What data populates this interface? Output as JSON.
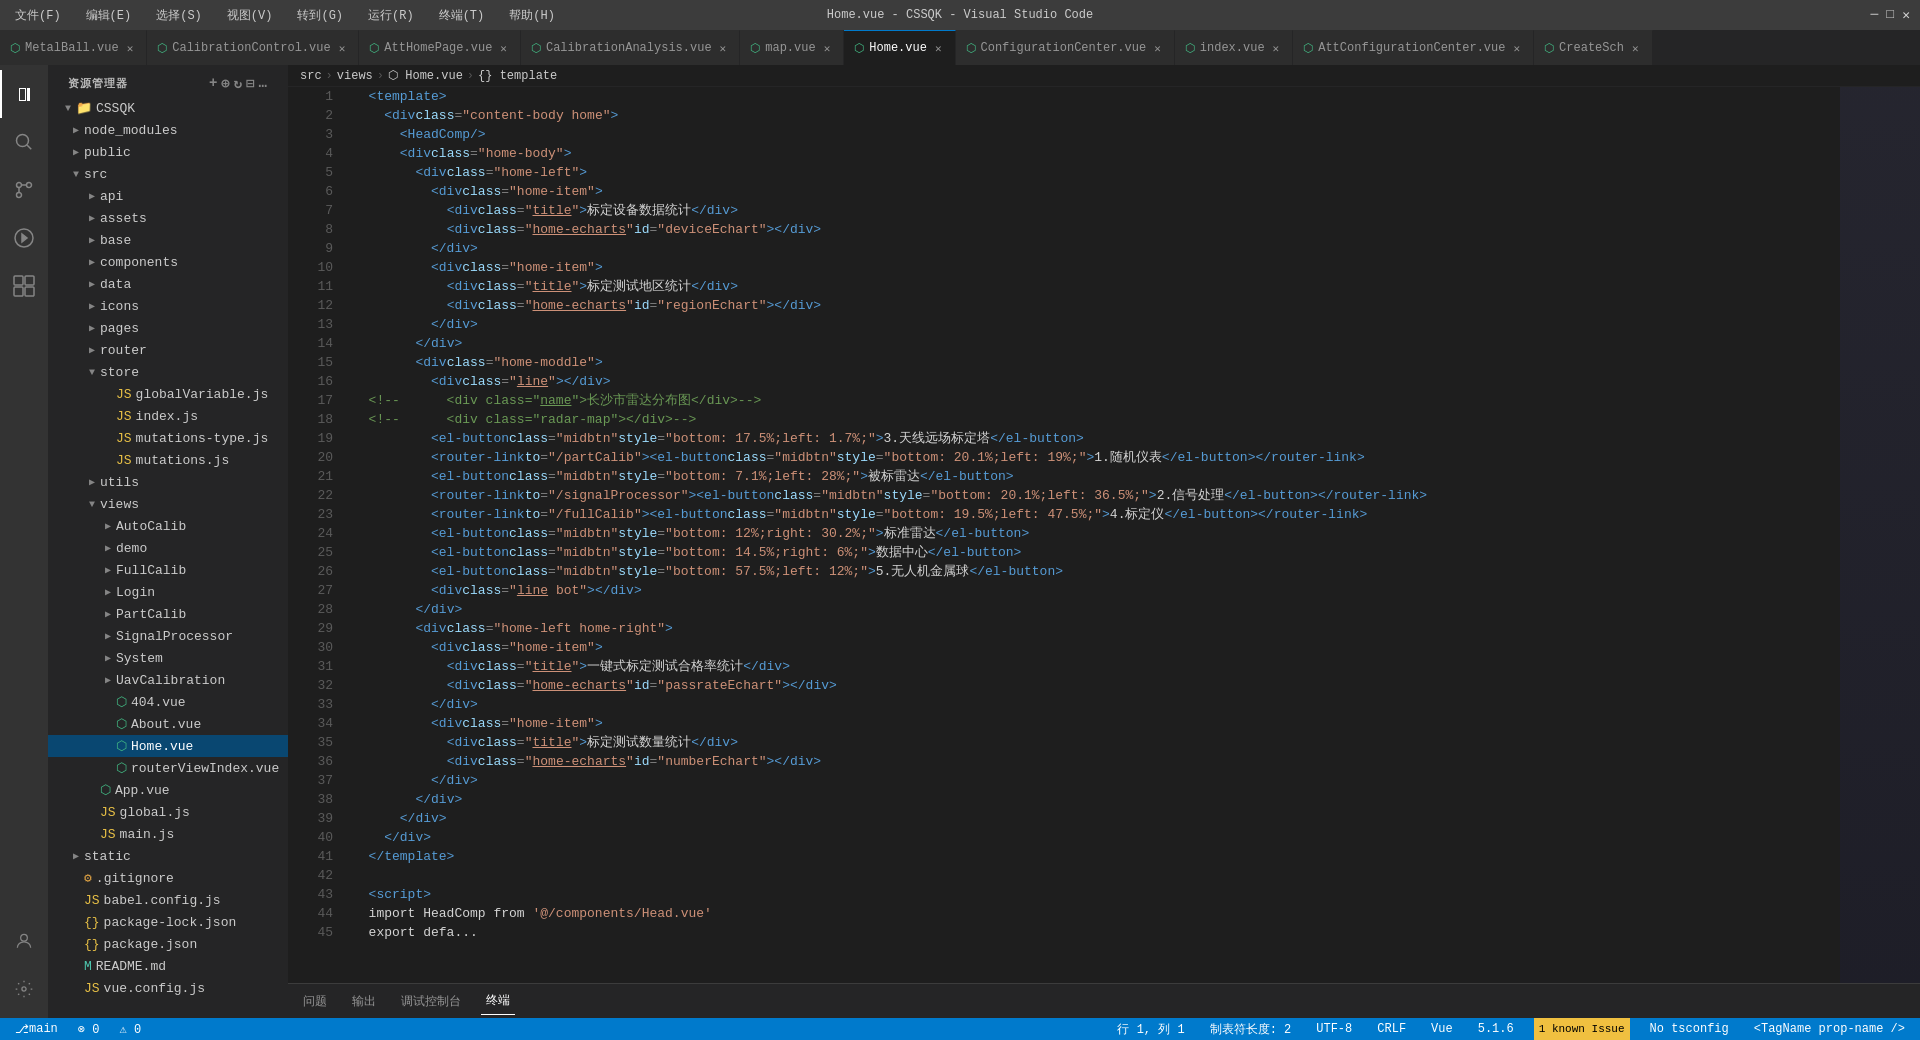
{
  "titleBar": {
    "title": "Home.vue - CSSQK - Visual Studio Code",
    "menu": [
      "文件(F)",
      "编辑(E)",
      "选择(S)",
      "视图(V)",
      "转到(G)",
      "运行(R)",
      "终端(T)",
      "帮助(H)"
    ]
  },
  "tabs": [
    {
      "id": "tab-metalball",
      "label": "MetalBall.vue",
      "active": false,
      "modified": false,
      "icon": "vue"
    },
    {
      "id": "tab-calibration",
      "label": "CalibrationControl.vue",
      "active": false,
      "modified": false,
      "icon": "vue"
    },
    {
      "id": "tab-atthome",
      "label": "AttHomePage.vue",
      "active": false,
      "modified": false,
      "icon": "vue"
    },
    {
      "id": "tab-calibanalysis",
      "label": "CalibrationAnalysis.vue",
      "active": false,
      "modified": false,
      "icon": "vue"
    },
    {
      "id": "tab-map",
      "label": "map.vue",
      "active": false,
      "modified": false,
      "icon": "vue"
    },
    {
      "id": "tab-homevue",
      "label": "Home.vue",
      "active": true,
      "modified": false,
      "icon": "vue"
    },
    {
      "id": "tab-configcenter",
      "label": "ConfigurationCenter.vue",
      "active": false,
      "modified": false,
      "icon": "vue"
    },
    {
      "id": "tab-index",
      "label": "index.vue",
      "active": false,
      "modified": false,
      "icon": "vue"
    },
    {
      "id": "tab-attconfig",
      "label": "AttConfigurationCenter.vue",
      "active": false,
      "modified": false,
      "icon": "vue"
    },
    {
      "id": "tab-createsch",
      "label": "CreateSch",
      "active": false,
      "modified": false,
      "icon": "vue"
    }
  ],
  "breadcrumb": {
    "items": [
      "src",
      "views",
      "Home.vue",
      "{} template"
    ]
  },
  "sidebar": {
    "title": "资源管理器",
    "root": "CSSQK",
    "tree": [
      {
        "label": "node_modules",
        "level": 1,
        "type": "folder",
        "open": false,
        "icon": "folder"
      },
      {
        "label": "public",
        "level": 1,
        "type": "folder",
        "open": false,
        "icon": "folder"
      },
      {
        "label": "src",
        "level": 1,
        "type": "folder",
        "open": true,
        "icon": "folder"
      },
      {
        "label": "api",
        "level": 2,
        "type": "folder",
        "open": false,
        "icon": "folder"
      },
      {
        "label": "assets",
        "level": 2,
        "type": "folder",
        "open": false,
        "icon": "folder"
      },
      {
        "label": "base",
        "level": 2,
        "type": "folder",
        "open": false,
        "icon": "folder"
      },
      {
        "label": "components",
        "level": 2,
        "type": "folder",
        "open": false,
        "icon": "folder"
      },
      {
        "label": "data",
        "level": 2,
        "type": "folder",
        "open": false,
        "icon": "folder"
      },
      {
        "label": "icons",
        "level": 2,
        "type": "folder",
        "open": false,
        "icon": "folder"
      },
      {
        "label": "pages",
        "level": 2,
        "type": "folder",
        "open": false,
        "icon": "folder"
      },
      {
        "label": "router",
        "level": 2,
        "type": "folder",
        "open": false,
        "icon": "folder"
      },
      {
        "label": "store",
        "level": 2,
        "type": "folder",
        "open": true,
        "icon": "folder"
      },
      {
        "label": "globalVariable.js",
        "level": 3,
        "type": "js",
        "icon": "js"
      },
      {
        "label": "index.js",
        "level": 3,
        "type": "js",
        "icon": "js"
      },
      {
        "label": "mutations-type.js",
        "level": 3,
        "type": "js",
        "icon": "js"
      },
      {
        "label": "mutations.js",
        "level": 3,
        "type": "js",
        "icon": "js"
      },
      {
        "label": "utils",
        "level": 2,
        "type": "folder",
        "open": false,
        "icon": "folder"
      },
      {
        "label": "views",
        "level": 2,
        "type": "folder",
        "open": true,
        "icon": "folder"
      },
      {
        "label": "AutoCalib",
        "level": 3,
        "type": "folder",
        "open": false,
        "icon": "folder"
      },
      {
        "label": "demo",
        "level": 3,
        "type": "folder",
        "open": false,
        "icon": "folder"
      },
      {
        "label": "FullCalib",
        "level": 3,
        "type": "folder",
        "open": false,
        "icon": "folder"
      },
      {
        "label": "Login",
        "level": 3,
        "type": "folder",
        "open": false,
        "icon": "folder"
      },
      {
        "label": "PartCalib",
        "level": 3,
        "type": "folder",
        "open": false,
        "icon": "folder"
      },
      {
        "label": "SignalProcessor",
        "level": 3,
        "type": "folder",
        "open": false,
        "icon": "folder"
      },
      {
        "label": "System",
        "level": 3,
        "type": "folder",
        "open": false,
        "icon": "folder"
      },
      {
        "label": "UavCalibration",
        "level": 3,
        "type": "folder",
        "open": false,
        "icon": "folder"
      },
      {
        "label": "404.vue",
        "level": 3,
        "type": "vue",
        "icon": "vue"
      },
      {
        "label": "About.vue",
        "level": 3,
        "type": "vue",
        "icon": "vue"
      },
      {
        "label": "Home.vue",
        "level": 3,
        "type": "vue",
        "active": true,
        "icon": "vue"
      },
      {
        "label": "routerViewIndex.vue",
        "level": 3,
        "type": "vue",
        "icon": "vue"
      },
      {
        "label": "App.vue",
        "level": 2,
        "type": "vue",
        "icon": "vue"
      },
      {
        "label": "global.js",
        "level": 2,
        "type": "js",
        "icon": "js"
      },
      {
        "label": "main.js",
        "level": 2,
        "type": "js",
        "icon": "js"
      },
      {
        "label": "static",
        "level": 1,
        "type": "folder",
        "open": false,
        "icon": "folder"
      },
      {
        "label": ".gitignore",
        "level": 1,
        "type": "git",
        "icon": "git"
      },
      {
        "label": "babel.config.js",
        "level": 1,
        "type": "js",
        "icon": "js"
      },
      {
        "label": "package-lock.json",
        "level": 1,
        "type": "json",
        "icon": "json"
      },
      {
        "label": "package.json",
        "level": 1,
        "type": "json",
        "icon": "json"
      },
      {
        "label": "README.md",
        "level": 1,
        "type": "md",
        "icon": "md"
      },
      {
        "label": "vue.config.js",
        "level": 1,
        "type": "js",
        "icon": "js"
      }
    ]
  },
  "code": [
    {
      "num": 1,
      "text": "  <template>"
    },
    {
      "num": 2,
      "text": "    <div class=\"content-body home\">"
    },
    {
      "num": 3,
      "text": "      <HeadComp/>"
    },
    {
      "num": 4,
      "text": "      <div class=\"home-body\">"
    },
    {
      "num": 5,
      "text": "        <div class=\"home-left\">"
    },
    {
      "num": 6,
      "text": "          <div class=\"home-item\">"
    },
    {
      "num": 7,
      "text": "            <div class=\"title\">标定设备数据统计</div>"
    },
    {
      "num": 8,
      "text": "            <div class=\"home-echarts\" id=\"deviceEchart\"></div>"
    },
    {
      "num": 9,
      "text": "          </div>"
    },
    {
      "num": 10,
      "text": "          <div class=\"home-item\">"
    },
    {
      "num": 11,
      "text": "            <div class=\"title\">标定测试地区统计</div>"
    },
    {
      "num": 12,
      "text": "            <div class=\"home-echarts\" id=\"regionEchart\"></div>"
    },
    {
      "num": 13,
      "text": "          </div>"
    },
    {
      "num": 14,
      "text": "        </div>"
    },
    {
      "num": 15,
      "text": "        <div class=\"home-moddle\">"
    },
    {
      "num": 16,
      "text": "          <div class=\"line\"></div>"
    },
    {
      "num": 17,
      "text": "  <!--      <div class=\"name\">长沙市雷达分布图</div>-->"
    },
    {
      "num": 18,
      "text": "  <!--      <div class=\"radar-map\"></div>-->"
    },
    {
      "num": 19,
      "text": "          <el-button class=\"midbtn\" style=\"bottom: 17.5%;left: 1.7%;\">3.天线远场标定塔</el-button>"
    },
    {
      "num": 20,
      "text": "          <router-link to=\"/partCalib\"><el-button class=\"midbtn\" style=\"bottom: 20.1%;left: 19%;\">1.随机仪表</el-button></router-link>"
    },
    {
      "num": 21,
      "text": "          <el-button class=\"midbtn\" style=\"bottom: 7.1%;left: 28%;\">被标雷达</el-button>"
    },
    {
      "num": 22,
      "text": "          <router-link to=\"/signalProcessor\"><el-button class=\"midbtn\" style=\"bottom: 20.1%;left: 36.5%;\">2.信号处理</el-button></router-link>"
    },
    {
      "num": 23,
      "text": "          <router-link to=\"/fullCalib\"><el-button class=\"midbtn\" style=\"bottom: 19.5%;left: 47.5%;\">4.标定仪</el-button></router-link>"
    },
    {
      "num": 24,
      "text": "          <el-button class=\"midbtn\" style=\"bottom: 12%;right: 30.2%;\">标准雷达</el-button>"
    },
    {
      "num": 25,
      "text": "          <el-button class=\"midbtn\" style=\"bottom: 14.5%;right: 6%;\">数据中心</el-button>"
    },
    {
      "num": 26,
      "text": "          <el-button class=\"midbtn\" style=\"bottom: 57.5%;left: 12%;\">5.无人机金属球</el-button>"
    },
    {
      "num": 27,
      "text": "          <div class=\"line bot\"></div>"
    },
    {
      "num": 28,
      "text": "        </div>"
    },
    {
      "num": 29,
      "text": "        <div class=\"home-left home-right\">"
    },
    {
      "num": 30,
      "text": "          <div class=\"home-item\">"
    },
    {
      "num": 31,
      "text": "            <div class=\"title\">一键式标定测试合格率统计</div>"
    },
    {
      "num": 32,
      "text": "            <div class=\"home-echarts\" id=\"passrateEchart\"></div>"
    },
    {
      "num": 33,
      "text": "          </div>"
    },
    {
      "num": 34,
      "text": "          <div class=\"home-item\">"
    },
    {
      "num": 35,
      "text": "            <div class=\"title\">标定测试数量统计</div>"
    },
    {
      "num": 36,
      "text": "            <div class=\"home-echarts\" id=\"numberEchart\"></div>"
    },
    {
      "num": 37,
      "text": "          </div>"
    },
    {
      "num": 38,
      "text": "        </div>"
    },
    {
      "num": 39,
      "text": "      </div>"
    },
    {
      "num": 40,
      "text": "    </div>"
    },
    {
      "num": 41,
      "text": "  </template>"
    },
    {
      "num": 42,
      "text": ""
    },
    {
      "num": 43,
      "text": "  <script>"
    },
    {
      "num": 44,
      "text": "  import HeadComp from '@/components/Head.vue'"
    },
    {
      "num": 45,
      "text": "  export defa..."
    }
  ],
  "panelTabs": [
    {
      "label": "问题",
      "active": false
    },
    {
      "label": "输出",
      "active": false
    },
    {
      "label": "调试控制台",
      "active": false
    },
    {
      "label": "终端",
      "active": true
    }
  ],
  "statusBar": {
    "left": [
      {
        "icon": "⎇",
        "text": "main"
      },
      {
        "icon": "⊗",
        "text": "0"
      },
      {
        "icon": "⚠",
        "text": "0"
      }
    ],
    "position": "行 1, 列 1",
    "indent": "制表符长度: 2",
    "encoding": "UTF-8",
    "lineEnding": "CRLF",
    "language": "Vue",
    "version": "5.1.6",
    "knownIssue": "1 known Issue",
    "noTsConfig": "No tsconfig",
    "tagName": "<TagName prop-name />"
  }
}
